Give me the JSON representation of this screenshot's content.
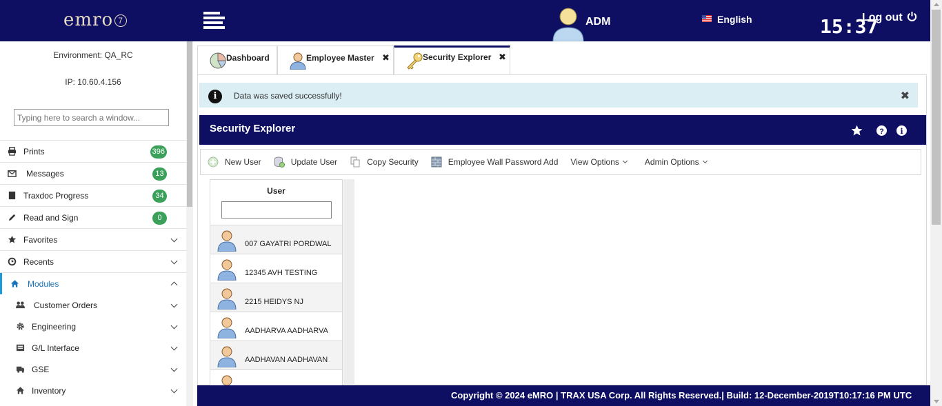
{
  "header": {
    "logo_text": "emro",
    "logo_version": "7",
    "user": "ADM",
    "language": "English",
    "clock": "15:37",
    "logout_label": "Log out"
  },
  "sidebar": {
    "environment": "Environment: QA_RC",
    "ip": "IP: 10.60.4.156",
    "search_placeholder": "Typing here to search a window...",
    "items": [
      {
        "label": "Prints",
        "icon": "printer-icon",
        "badge": "396"
      },
      {
        "label": "Messages",
        "icon": "envelope-icon",
        "badge": "13"
      },
      {
        "label": "Traxdoc Progress",
        "icon": "book-icon",
        "badge": "34"
      },
      {
        "label": "Read and Sign",
        "icon": "pencil-icon",
        "badge": "0"
      },
      {
        "label": "Favorites",
        "icon": "star-icon"
      },
      {
        "label": "Recents",
        "icon": "clock-icon"
      },
      {
        "label": "Modules",
        "icon": "home-icon"
      }
    ],
    "modules": [
      {
        "label": "Customer Orders",
        "icon": "users-icon"
      },
      {
        "label": "Engineering",
        "icon": "gear-icon"
      },
      {
        "label": "G/L Interface",
        "icon": "ledger-icon"
      },
      {
        "label": "GSE",
        "icon": "truck-icon"
      },
      {
        "label": "Inventory",
        "icon": "home-icon"
      }
    ]
  },
  "tabs": [
    {
      "label": "Dashboard",
      "icon": "pie-chart-icon"
    },
    {
      "label": "Employee Master",
      "icon": "person-icon",
      "close": "✖"
    },
    {
      "label": "Security Explorer",
      "icon": "key-icon",
      "close": "✖"
    }
  ],
  "alert": {
    "message": "Data was saved successfully!",
    "close": "✖"
  },
  "panel": {
    "title": "Security Explorer"
  },
  "toolbar": {
    "new_user": "New User",
    "update_user": "Update User",
    "copy_security": "Copy Security",
    "employee_wall_password_add": "Employee Wall Password Add",
    "view_options": "View Options",
    "admin_options": "Admin Options"
  },
  "user_grid": {
    "header": "User",
    "rows": [
      "007 GAYATRI PORDWAL",
      "12345 AVH TESTING",
      "2215 HEIDYS NJ",
      "AADHARVA AADHARVA",
      "AADHAVAN AADHAVAN",
      ""
    ]
  },
  "footer": {
    "text": "Copyright © 2024 eMRO | TRAX USA Corp. All Rights Reserved.| Build: 12-December-2019T10:17:16 PM UTC"
  },
  "colors": {
    "navy": "#0e0e63",
    "badge_green": "#3aa05a",
    "alert_bg": "#daeef4",
    "active_link": "#1a73b8"
  }
}
